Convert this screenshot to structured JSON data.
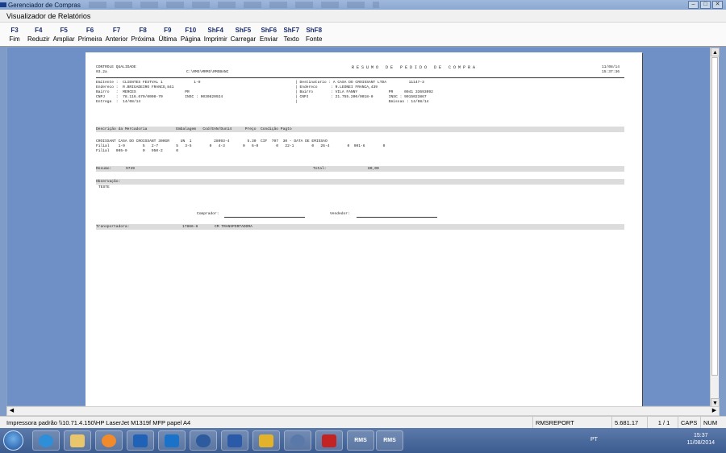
{
  "window": {
    "outer_title": "Gerenciador de Compras",
    "inner_title": "Visualizador de Relatórios"
  },
  "toolbar": [
    {
      "key": "F3",
      "label": "Fim"
    },
    {
      "key": "F4",
      "label": "Reduzir"
    },
    {
      "key": "F5",
      "label": "Ampliar"
    },
    {
      "key": "F6",
      "label": "Primeira"
    },
    {
      "key": "F7",
      "label": "Anterior"
    },
    {
      "key": "F8",
      "label": "Próxima"
    },
    {
      "key": "F9",
      "label": "Última"
    },
    {
      "key": "F10",
      "label": "Página"
    },
    {
      "key": "ShF4",
      "label": "Imprimir"
    },
    {
      "key": "ShF5",
      "label": "Carregar"
    },
    {
      "key": "ShF6",
      "label": "Enviar"
    },
    {
      "key": "ShF7",
      "label": "Texto"
    },
    {
      "key": "ShF8",
      "label": "Fonte"
    }
  ],
  "report": {
    "company": "CONTROLE QUALIDADE",
    "code": "03.2a",
    "path": "C:\\RMS\\MRMS\\RMSBANC",
    "title": "R E S U M O   D E   P E D I D O   D E   C O M P R A",
    "date": "11/08/14",
    "time": "15:37:36",
    "issuer": {
      "line1": "Emitente :  CLIENTES FESTVAL 1              1-9",
      "line2": "Endereco :  R.BRIGADEIRO FRANCO,841",
      "line3": "Bairro   :  MERCES                      PR",
      "line4": "CNPJ     :  78.116.670/0008-70          INSC : 9030820924",
      "line5": "Entrega  :  14/08/14"
    },
    "dest": {
      "line1": "| Destinatario : A CASA DO CROISSANT LTDA          11147-3",
      "line2": "| Endereco      : R.LEONEI FRANCA,439",
      "line3": "| Bairro        : VILA FANNY              PR     0041 33693092",
      "line4": "| CNPJ          : 21.755.200/0018-0       INSC : 9015023867",
      "line5": "|                                         Emissao : 14/08/14"
    },
    "items_header": "Descrição da Mercadoria             Embalagem   Cod/EAN/Dun14      Preço  Condição Pagto",
    "item_line1": "CROISSANT CASA DO CROISSANT 300GR     UN  1          28093-4        5.30  CIF  707  30 - DATA DE EMISSAO",
    "item_line2": "Filial    1-9        5   2-7        5   3-5        0   4-3        0   6-0        0   22-1        0   26-4        0  901-6        0",
    "item_line3": "Filial   905-9       0   950-2      0",
    "resumo_label": "Resumo:",
    "resumo_value": "9749",
    "total_label": "Total:",
    "total_value": "80,00",
    "obs_label": "Observação:",
    "obs_value": "TESTE",
    "comprador": "Comprador:",
    "vendedor": "Vendedor:",
    "transp_label": "Transportadora:",
    "transp_code": "17866-8",
    "transp_name": "CM TRANSPORTADORA"
  },
  "status": {
    "printer": "Impressora padrão \\\\10.71.4.150\\HP LaserJet M1319f MFP papel A4",
    "module": "RMSREPORT",
    "value": "5.681.17",
    "pages": "1 / 1",
    "caps": "CAPS",
    "num": "NUM"
  },
  "taskbar": {
    "lang": "PT",
    "time": "15:37",
    "date": "11/08/2014",
    "apps": [
      "ie",
      "explorer",
      "outlook-like",
      "outlook",
      "lync",
      "infinity",
      "word",
      "desktop-tool",
      "network-tool",
      "pdf",
      "rms",
      "rms"
    ],
    "rms_label": "RMS"
  }
}
